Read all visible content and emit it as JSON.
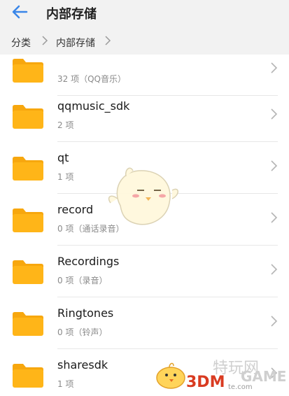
{
  "header": {
    "title": "内部存储"
  },
  "breadcrumb": {
    "items": [
      "分类",
      "内部存储"
    ]
  },
  "folders": [
    {
      "name": "",
      "meta": "32 项（QQ音乐）"
    },
    {
      "name": "qqmusic_sdk",
      "meta": "2 项"
    },
    {
      "name": "qt",
      "meta": "1 项"
    },
    {
      "name": "record",
      "meta": "0 项（通话录音）"
    },
    {
      "name": "Recordings",
      "meta": "0 项（录音）"
    },
    {
      "name": "Ringtones",
      "meta": "0 项（铃声）"
    },
    {
      "name": "sharesdk",
      "meta": "1 项"
    }
  ],
  "watermark": {
    "brand": "3DM",
    "game_text": "GAME",
    "chars": "特玩网",
    "url": "te.com"
  },
  "colors": {
    "accent": "#3a86e8",
    "folder": "#ffb518",
    "folder_tab": "#f7a70e"
  }
}
